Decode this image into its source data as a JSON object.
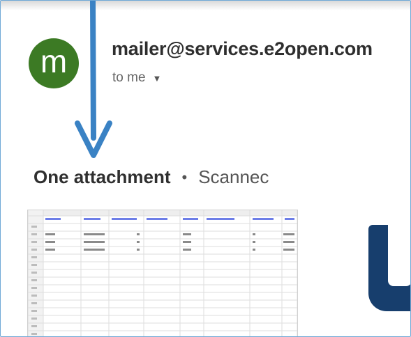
{
  "email": {
    "avatar_letter": "m",
    "avatar_color": "#3c7a24",
    "sender": "mailer@services.e2open.com",
    "recipient": "to me",
    "recipient_caret_icon": "caret-down-icon"
  },
  "attachments": {
    "title": "One attachment",
    "separator": "•",
    "scan_label": "Scannec"
  },
  "annotation": {
    "arrow_color": "#3a82c4",
    "arrow_icon": "arrow-down-icon"
  },
  "thumbnail": {
    "preview_icon": "spreadsheet-preview-icon"
  }
}
